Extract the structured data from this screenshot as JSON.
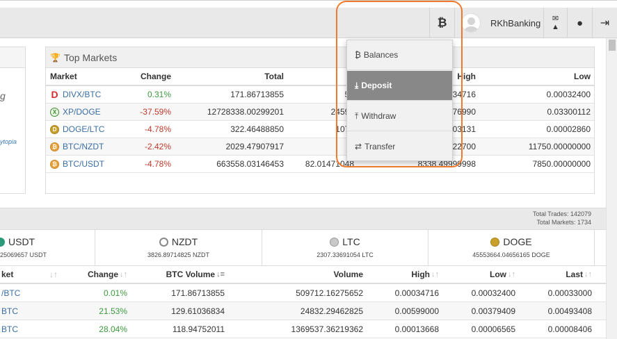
{
  "navbar": {
    "btc_icon": "bitcoin-icon",
    "username": "RKhBanking",
    "notify_icon": "envelope-warning-icon",
    "bulb_icon": "lightbulb-icon",
    "logout_icon": "sign-out-icon"
  },
  "dropdown": {
    "items": [
      {
        "label": "Balances",
        "icon": "bitcoin-icon"
      },
      {
        "label": "Deposit",
        "icon": "download-icon"
      },
      {
        "label": "Withdraw",
        "icon": "upload-icon"
      },
      {
        "label": "Transfer",
        "icon": "exchange-icon"
      }
    ],
    "active_index": 1
  },
  "left_panel": {
    "fragment_text": "g",
    "fragment_link": "ytopia"
  },
  "top_markets": {
    "title": "Top Markets",
    "columns": {
      "market": "Market",
      "change": "Change",
      "total": "Total",
      "high": "High",
      "low": "Low"
    },
    "rows": [
      {
        "market": "DIVX/BTC",
        "change": "0.31%",
        "total": "171.86713855",
        "volume": "50",
        "high": "0.00034716",
        "low": "0.00032400"
      },
      {
        "market": "XP/DOGE",
        "change": "-37.59%",
        "total": "12728338.00299201",
        "volume": "24593",
        "high": "0.06876990",
        "low": "0.03300112"
      },
      {
        "market": "DOGE/LTC",
        "change": "-4.78%",
        "total": "322.46488850",
        "volume": "1078",
        "high": "0.00003131",
        "low": "0.00002860"
      },
      {
        "market": "BTC/NZDT",
        "change": "-2.42%",
        "total": "2029.47907917",
        "volume": "",
        "high": "3.25422700",
        "low": "11750.00000000"
      },
      {
        "market": "BTC/USDT",
        "change": "-4.78%",
        "total": "663558.03146453",
        "volume": "82.01471048",
        "high": "8338.49999998",
        "low": "7850.00000000"
      }
    ]
  },
  "bottom": {
    "total_trades": "Total Trades: 142079",
    "total_markets": "Total Markets: 1734",
    "coins": [
      {
        "name": "USDT",
        "volume": "25069657 USDT"
      },
      {
        "name": "NZDT",
        "volume": "3826.89714825 NZDT"
      },
      {
        "name": "LTC",
        "volume": "2307.33691054 LTC"
      },
      {
        "name": "DOGE",
        "volume": "45553664.04656165 DOGE"
      }
    ],
    "columns": {
      "market": "ket",
      "change": "Change",
      "btc_volume": "BTC Volume",
      "volume": "Volume",
      "high": "High",
      "low": "Low",
      "last": "Last"
    },
    "rows": [
      {
        "market": "/BTC",
        "change": "0.01%",
        "btc_volume": "171.86713855",
        "volume": "509712.16275652",
        "high": "0.00034716",
        "low": "0.00032400",
        "last": "0.00033000"
      },
      {
        "market": "BTC",
        "change": "21.53%",
        "btc_volume": "129.61036834",
        "volume": "24832.29462825",
        "high": "0.00599000",
        "low": "0.00379409",
        "last": "0.00493408"
      },
      {
        "market": "BTC",
        "change": "28.04%",
        "btc_volume": "118.94752011",
        "volume": "1369537.36219362",
        "high": "0.00013668",
        "low": "0.00006565",
        "last": "0.00008406"
      }
    ]
  }
}
